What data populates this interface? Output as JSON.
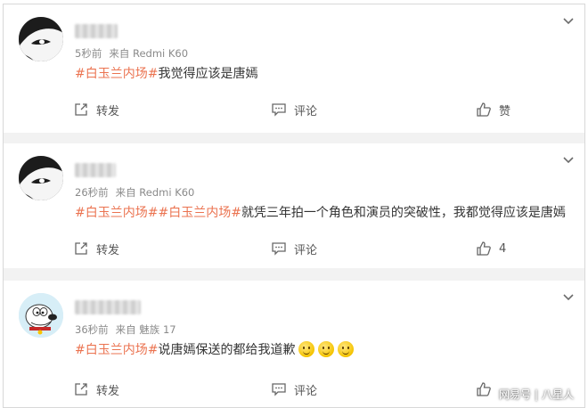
{
  "comments": [
    {
      "time": "5秒前",
      "source": "来自 Redmi K60",
      "content": [
        {
          "type": "tag",
          "text": "#白玉兰内场#"
        },
        {
          "type": "text",
          "text": "我觉得应该是唐嫣"
        }
      ],
      "actions": {
        "repost": "转发",
        "comment": "评论",
        "like": "赞"
      }
    },
    {
      "time": "26秒前",
      "source": "来自 Redmi K60",
      "content": [
        {
          "type": "tag",
          "text": "#白玉兰内场#"
        },
        {
          "type": "tag",
          "text": "#白玉兰内场#"
        },
        {
          "type": "text",
          "text": "就凭三年拍一个角色和演员的突破性，我都觉得应该是唐嫣"
        }
      ],
      "actions": {
        "repost": "转发",
        "comment": "评论",
        "like": "4"
      }
    },
    {
      "time": "36秒前",
      "source": "来自 魅族 17",
      "content": [
        {
          "type": "tag",
          "text": "#白玉兰内场#"
        },
        {
          "type": "text",
          "text": "说唐嫣保送的都给我道歉"
        },
        {
          "type": "emoji",
          "name": "smile-emoji"
        },
        {
          "type": "emoji",
          "name": "smile-emoji"
        },
        {
          "type": "emoji",
          "name": "smile-emoji"
        }
      ],
      "actions": {
        "repost": "转发",
        "comment": "评论",
        "like": ""
      }
    }
  ],
  "watermark": {
    "brand": "网易号",
    "separator": "|",
    "author": "八星人"
  },
  "colors": {
    "tag": "#eb7350",
    "text": "#333333",
    "meta": "#8a8a8a",
    "background": "#f2f2f2"
  },
  "icons": {
    "chevron": "chevron-down-icon",
    "repost": "repost-icon",
    "comment": "comment-icon",
    "like": "thumbs-up-icon"
  }
}
